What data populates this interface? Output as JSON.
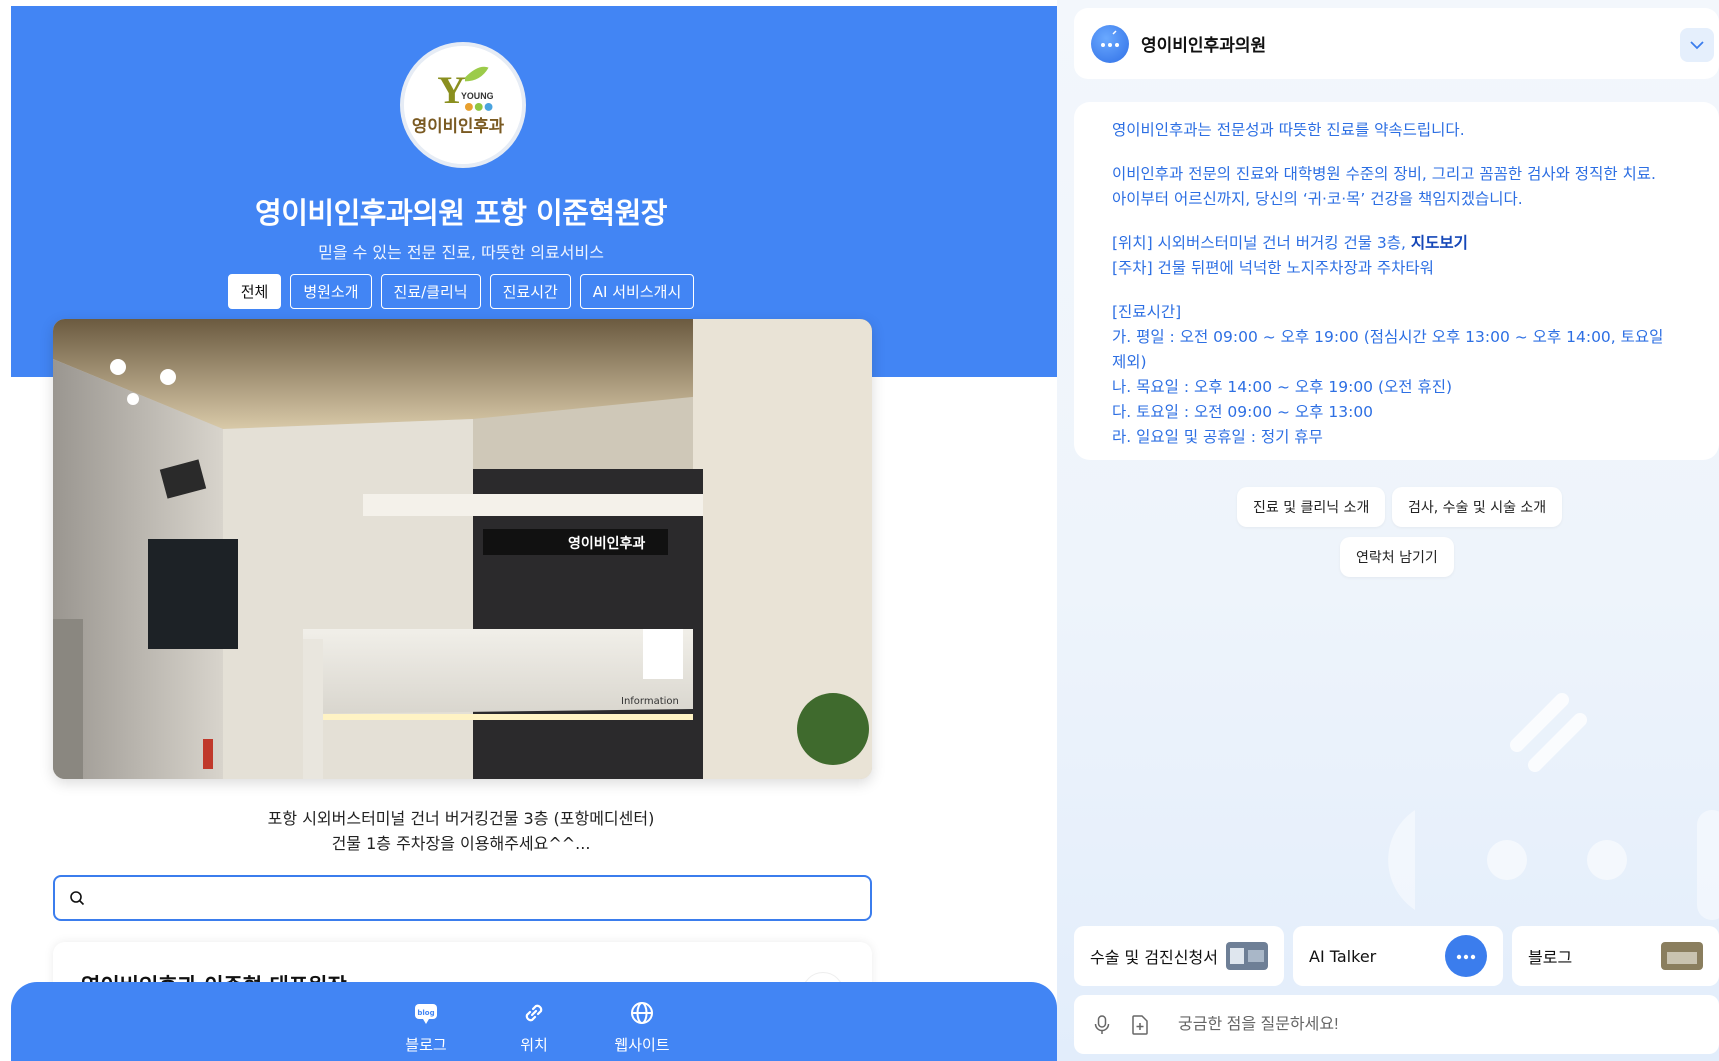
{
  "left": {
    "logo_text": "영이비인후과",
    "logo_brand": "YOUNG",
    "title": "영이비인후과의원 포항 이준혁원장",
    "subtitle": "믿을 수 있는 전문 진료, 따뜻한 의료서비스",
    "tabs": [
      {
        "label": "전체",
        "active": true
      },
      {
        "label": "병원소개"
      },
      {
        "label": "진료/클리닉"
      },
      {
        "label": "진료시간"
      },
      {
        "label": "AI 서비스개시"
      }
    ],
    "photo_sign": "영이비인후과",
    "photo_counter": "Information",
    "address_line1": "포항 시외버스터미널 건너 버거킹건물 3층 (포항메디센터)",
    "address_line2": "건물 1층 주차장을 이용해주세요^^...",
    "search_placeholder": "",
    "card_title": "영이비인후과 이준혁 대표원장",
    "nav": [
      {
        "label": "블로그",
        "icon": "blog-icon"
      },
      {
        "label": "위치",
        "icon": "link-icon"
      },
      {
        "label": "웹사이트",
        "icon": "globe-icon"
      }
    ],
    "colors": {
      "brand_blue": "#4285f4",
      "search_border": "#3b7ded"
    }
  },
  "chat": {
    "name": "영이비인후과의원",
    "message": {
      "p1": "영이비인후과는 전문성과 따뜻한 진료를 약속드립니다.",
      "p2a": "이비인후과 전문의 진료와 대학병원 수준의 장비, 그리고 꼼꼼한 검사와 정직한 치료.",
      "p2b": "아이부터 어르신까지, 당신의 ‘귀·코·목’ 건강을 책임지겠습니다.",
      "p3a": "[위치] 시외버스터미널 건너 버거킹 건물 3층, ",
      "p3a_link": "지도보기",
      "p3b": "[주차] 건물 뒤편에 넉넉한 노지주차장과 주차타워",
      "p4a": "[진료시간]",
      "p4b": "가. 평일 : 오전 09:00 ~ 오후 19:00 (점심시간 오후 13:00 ~ 오후 14:00, 토요일 제외)",
      "p4c": "나. 목요일 : 오후 14:00 ~ 오후 19:00 (오전 휴진)",
      "p4d": "다. 토요일 : 오전 09:00 ~ 오후 13:00",
      "p4e": "라. 일요일 및 공휴일 : 정기 휴무"
    },
    "chips": [
      "진료 및 클리닉 소개",
      "검사, 수술 및 시술 소개",
      "연락처 남기기"
    ],
    "quick": [
      {
        "label": "수술 및 검진신청서"
      },
      {
        "label": "AI Talker"
      },
      {
        "label": "블로그"
      }
    ],
    "input_placeholder": "궁금한 점을 질문하세요!",
    "colors": {
      "message_text": "#2d6fe3",
      "link_text": "#1547b8"
    }
  }
}
